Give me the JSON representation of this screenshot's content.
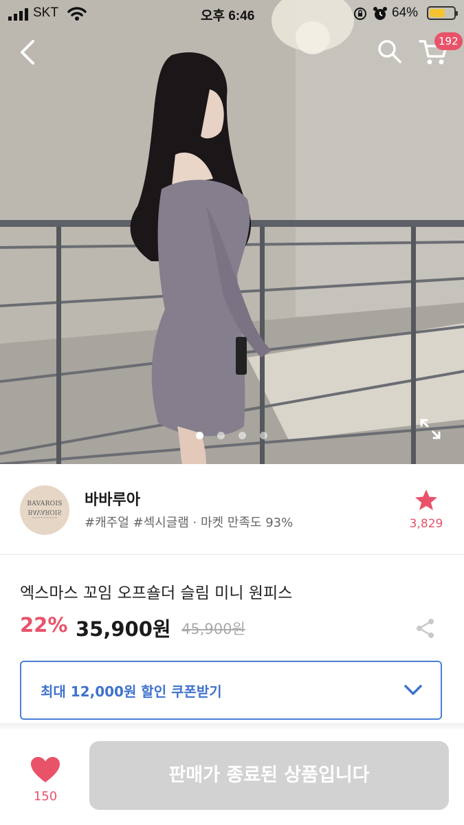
{
  "status_bar": {
    "carrier": "SKT",
    "time": "오후 6:46",
    "battery_percent": "64%",
    "battery_level": 0.64
  },
  "header": {
    "cart_badge": "192",
    "icons": [
      "back-icon",
      "search-icon",
      "cart-icon"
    ]
  },
  "gallery": {
    "image_count": 4,
    "active_index": 0,
    "icons": [
      "expand-icon"
    ]
  },
  "shop": {
    "logo_text": "BAVAROIS",
    "name": "바바루아",
    "tags": "#캐주얼 #섹시글램 · 마켓 만족도 93%",
    "star_count": "3,829"
  },
  "product": {
    "title": "엑스마스 꼬임 오프숄더 슬림 미니 원피스",
    "discount": "22%",
    "price": "35,900원",
    "original_price": "45,900원"
  },
  "coupon": {
    "label": "최대 12,000원 할인 쿠폰받기"
  },
  "bottom_bar": {
    "like_count": "150",
    "buy_button_label": "판매가 종료된 상품입니다"
  },
  "colors": {
    "accent_red": "#e9536a",
    "coupon_blue": "#3f72cc",
    "disabled_gray": "#d2d2d2"
  }
}
